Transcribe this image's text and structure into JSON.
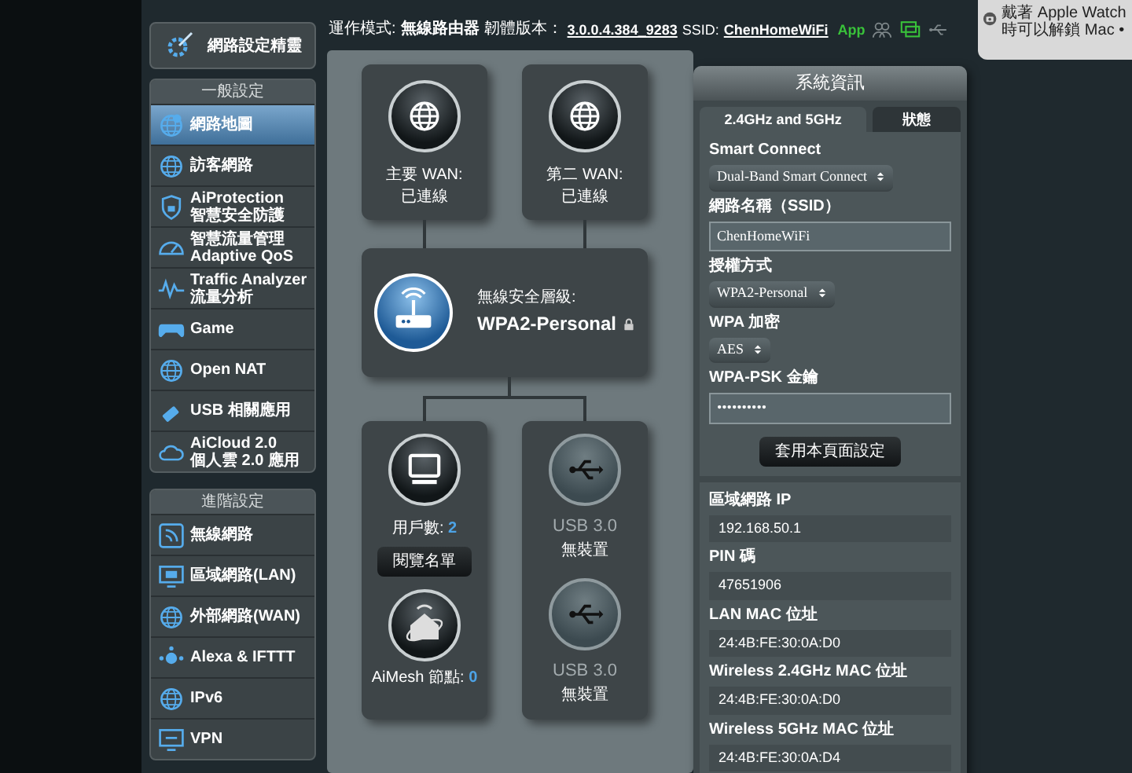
{
  "notification": {
    "text": "戴著 Apple Watch時可以解鎖 Mac •"
  },
  "top_info": {
    "mode_label": "運作模式:",
    "mode": "無線路由器",
    "firmware_label": "韌體版本：",
    "firmware": "3.0.0.4.384_9283",
    "ssid_label": "SSID:",
    "ssid": "ChenHomeWiFi",
    "app": "App"
  },
  "status_icons": [
    {
      "kind": "users",
      "active": false
    },
    {
      "kind": "monitor",
      "active": true
    },
    {
      "kind": "usb",
      "active": false
    }
  ],
  "sidebar": {
    "wizard": "網路設定精靈",
    "groups": [
      {
        "title": "一般設定",
        "items": [
          {
            "kind": "map",
            "label": "網路地圖",
            "selected": true
          },
          {
            "kind": "guest",
            "label": "訪客網路",
            "selected": false
          },
          {
            "kind": "shield",
            "label": "AiProtection",
            "sublabel": "智慧安全防護",
            "selected": false
          },
          {
            "kind": "gauge",
            "label": "智慧流量管理 Adaptive QoS",
            "selected": false
          },
          {
            "kind": "wave",
            "label": "Traffic Analyzer",
            "sublabel": "流量分析",
            "selected": false
          },
          {
            "kind": "gamepad",
            "label": "Game",
            "selected": false
          },
          {
            "kind": "nat",
            "label": "Open NAT",
            "selected": false
          },
          {
            "kind": "usb",
            "label": "USB 相關應用",
            "selected": false
          },
          {
            "kind": "cloud",
            "label": "AiCloud 2.0",
            "sublabel": "個人雲 2.0 應用",
            "selected": false
          }
        ]
      },
      {
        "title": "進階設定",
        "items": [
          {
            "kind": "wifi",
            "label": "無線網路",
            "selected": false
          },
          {
            "kind": "lan",
            "label": "區域網路(LAN)",
            "selected": false
          },
          {
            "kind": "wan",
            "label": "外部網路(WAN)",
            "selected": false
          },
          {
            "kind": "alexa",
            "label": "Alexa & IFTTT",
            "selected": false
          },
          {
            "kind": "ipv6",
            "label": "IPv6",
            "selected": false
          },
          {
            "kind": "vpn",
            "label": "VPN",
            "selected": false
          }
        ]
      }
    ]
  },
  "network_map": {
    "wan": [
      {
        "title": "主要 WAN:",
        "status": "已連線"
      },
      {
        "title": "第二 WAN:",
        "status": "已連線"
      }
    ],
    "router": {
      "label": "無線安全層級:",
      "value": "WPA2-Personal"
    },
    "clients": {
      "label": "用戶數:",
      "count": "2",
      "button": "閱覽名單"
    },
    "aimesh": {
      "label": "AiMesh 節點:",
      "count": "0"
    },
    "usb": [
      {
        "title": "USB 3.0",
        "status": "無裝置"
      },
      {
        "title": "USB 3.0",
        "status": "無裝置"
      }
    ]
  },
  "system_info": {
    "title": "系統資訊",
    "tabs": [
      {
        "label": "2.4GHz and 5GHz",
        "selected": true
      },
      {
        "label": "狀態",
        "selected": false
      }
    ],
    "fields": [
      {
        "kind": "select",
        "label": "Smart Connect",
        "value": "Dual-Band Smart Connect"
      },
      {
        "kind": "text",
        "label": "網路名稱（SSID）",
        "value": "ChenHomeWiFi"
      },
      {
        "kind": "select",
        "label": "授權方式",
        "value": "WPA2-Personal"
      },
      {
        "kind": "select",
        "label": "WPA 加密",
        "value": "AES"
      },
      {
        "kind": "text",
        "label": "WPA-PSK 金鑰",
        "value": "••••••••••"
      }
    ],
    "apply_button": "套用本頁面設定",
    "info": [
      {
        "label": "區域網路 IP",
        "value": "192.168.50.1"
      },
      {
        "label": "PIN 碼",
        "value": "47651906"
      },
      {
        "label": "LAN MAC 位址",
        "value": "24:4B:FE:30:0A:D0"
      },
      {
        "label": "Wireless 2.4GHz MAC 位址",
        "value": "24:4B:FE:30:0A:D0"
      },
      {
        "label": "Wireless 5GHz MAC 位址",
        "value": "24:4B:FE:30:0A:D4"
      }
    ]
  }
}
